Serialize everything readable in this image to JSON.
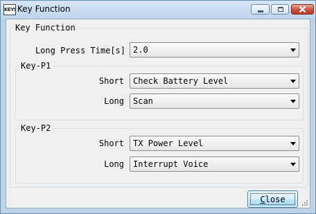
{
  "window": {
    "title": "Key Function",
    "icon_text": "KEYS",
    "controls": {
      "minimize": "minimize-icon",
      "maximize": "maximize-icon",
      "close": "close-icon"
    }
  },
  "main_group": {
    "title": "Key Function",
    "long_press_label": "Long Press Time[s]",
    "long_press_value": "2.0"
  },
  "key_p1": {
    "title": "Key-P1",
    "short_label": "Short",
    "short_value": "Check Battery Level",
    "long_label": "Long",
    "long_value": "Scan"
  },
  "key_p2": {
    "title": "Key-P2",
    "short_label": "Short",
    "short_value": "TX Power Level",
    "long_label": "Long",
    "long_value": "Interrupt Voice"
  },
  "footer": {
    "close_label": "Close"
  },
  "colors": {
    "frame": "#bcd3ea",
    "client": "#f0f0f0",
    "close_button": "#c8513c",
    "default_button_border": "#3c7fb1"
  }
}
